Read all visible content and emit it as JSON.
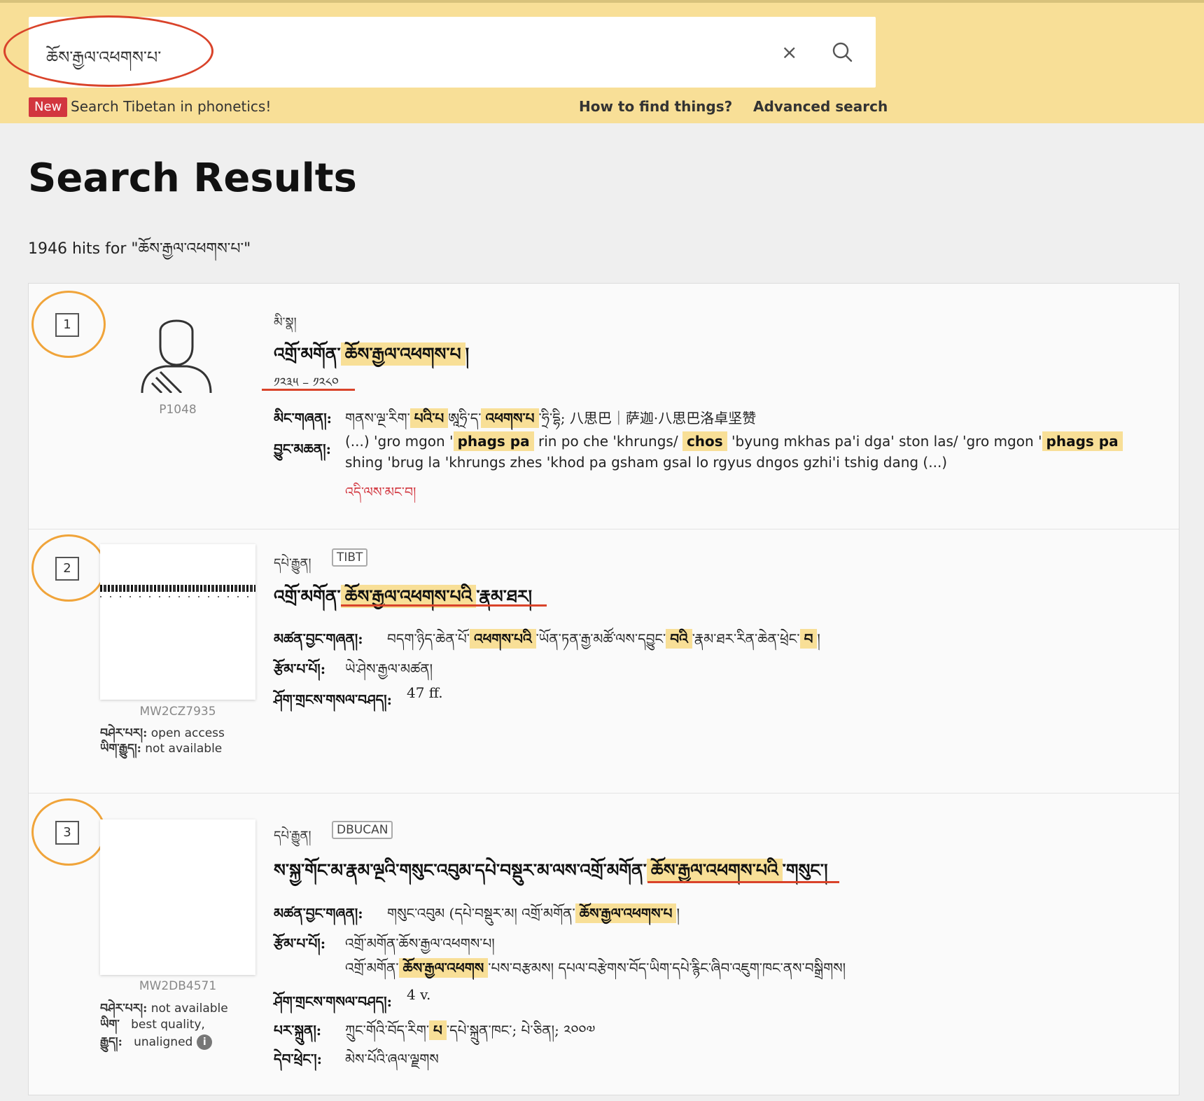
{
  "search": {
    "value": "ཆོས་རྒྱལ་འཕགས་པ་",
    "clear_label": "×"
  },
  "promo": {
    "badge": "New",
    "text": "Search Tibetan in phonetics!"
  },
  "nav": {
    "how_to": "How to find things?",
    "advanced": "Advanced search"
  },
  "page": {
    "title": "Search Results",
    "hits": "1946 hits for \"ཆོས་རྒྱལ་འཕགས་པ་\""
  },
  "results": [
    {
      "number": "1",
      "kind": "མི་སྣ།",
      "id": "P1048",
      "title_pre": "འགྲོ་མགོན་",
      "title_hl": "ཆོས་རྒྱལ་འཕགས་པ",
      "title_post": "།",
      "dates": "༡༢༣༥ – ༡༢༨༠",
      "name_label": "མིང་གཞན།:",
      "name_value": {
        "p1": "གནས་ལྔ་རིག་",
        "h1": "པའི་པ",
        "p2": "ཨཱཧྲི་ད་",
        "h2": "འཕགས་པ",
        "p3": "་ཧྲི་དྷི; 八思巴｜萨迦·八思巴洛卓坚赞"
      },
      "source_label": "བྱུང་མཆན།:",
      "snippet": {
        "s1": "(...) 'gro mgon '",
        "h1": "phags pa",
        "s2": " rin po che 'khrungs/ ",
        "h2": "chos",
        "s3": " 'byung mkhas pa'i dga' ston las/ 'gro mgon '",
        "h3": "phags pa",
        "s4": " shing 'brug la 'khrungs zhes 'khod pa gsham gsal lo rgyus dngos gzhi'i tshig dang (...)"
      },
      "more": "འདི་ལས་མང་བ།"
    },
    {
      "number": "2",
      "kind": "དཔེ་རྒྱུན།",
      "tag": "TIBT",
      "id": "MW2CZ7935",
      "access_label": "བཤེར་པར།:",
      "access_value": "open access",
      "etext_label": "ཡིག་རྒྱུད།:",
      "etext_value": "not available",
      "title_pre": "འགྲོ་མགོན་",
      "title_hl": "ཆོས་རྒྱལ་འཕགས་པའི",
      "title_post": "་རྣམ་ཐར།",
      "other_title_label": "མཚན་བྱང་གཞན།:",
      "other_title": {
        "p1": "བདག་ཉིད་ཆེན་པོ་",
        "h1": "འཕགས་པའི",
        "p2": "་ཡོན་ཏན་རྒྱ་མཚོ་ལས་དབྱུང་",
        "h2": "བའི",
        "p3": "་རྣམ་ཐར་རིན་ཆེན་ཕྲེང་",
        "h3": "བ",
        "p4": "།"
      },
      "author_label": "རྩོམ་པ་པོ།:",
      "author": "ཡེ་ཤེས་རྒྱལ་མཚན།",
      "extent_label": "ཤོག་གྲངས་གསལ་བཤད།:",
      "extent": "47 ff."
    },
    {
      "number": "3",
      "kind": "དཔེ་རྒྱུན།",
      "tag": "DBUCAN",
      "id": "MW2DB4571",
      "access_label": "བཤེར་པར།:",
      "access_value": "not available",
      "etext_label": "ཡིག་",
      "etext_label2": "རྒྱུད།:",
      "etext_value": "best quality,",
      "etext_value2": "unaligned",
      "title_pre": "ས་སྐྱ་གོང་མ་རྣམ་ལྔའི་གསུང་འབུམ་དཔེ་བསྡུར་མ་ལས་འགྲོ་མགོན་",
      "title_hl": "ཆོས་རྒྱལ་འཕགས་པའི",
      "title_post": "་གསུང་།",
      "other_title_label": "མཚན་བྱང་གཞན།:",
      "other_title": {
        "p1": "གསུང་འབུམ  (དཔེ་བསྡུར་མ། འགྲོ་མགོན་",
        "h1": "ཆོས་རྒྱལ་འཕགས་པ",
        "p2": "།"
      },
      "author_label": "རྩོམ་པ་པོ།:",
      "author1": "འགྲོ་མགོན་ཆོས་རྒྱལ་འཕགས་པ།",
      "author2": {
        "p1": "འགྲོ་མགོན་",
        "h1": "ཆོས་རྒྱལ་འཕགས",
        "p2": "་པས་བརྩམས། དཔལ་བརྩེགས་བོད་ཡིག་དཔེ་རྙིང་ཞིབ་འཇུག་ཁང་ནས་བསྒྲིགས།"
      },
      "extent_label": "ཤོག་གྲངས་གསལ་བཤད།:",
      "extent": "4 v.",
      "pub_label": "པར་སྐྲུན།:",
      "pub": {
        "p1": "ཀྲུང་གོའི་བོད་རིག་",
        "h1": "པ",
        "p2": "་དཔེ་སྐྲུན་ཁང་; པེ་ཅིན།; ༢༠༠༧"
      },
      "series_label": "དེབ་ཕྲེང་།:",
      "series": "མེས་པོའི་ཞལ་ལྗགས"
    }
  ],
  "colors": {
    "topbar": "#f8df97",
    "highlight": "#f8df97",
    "badge": "#d2363f",
    "annotation_red": "#d9432a",
    "annotation_orange": "#f0a43a"
  }
}
